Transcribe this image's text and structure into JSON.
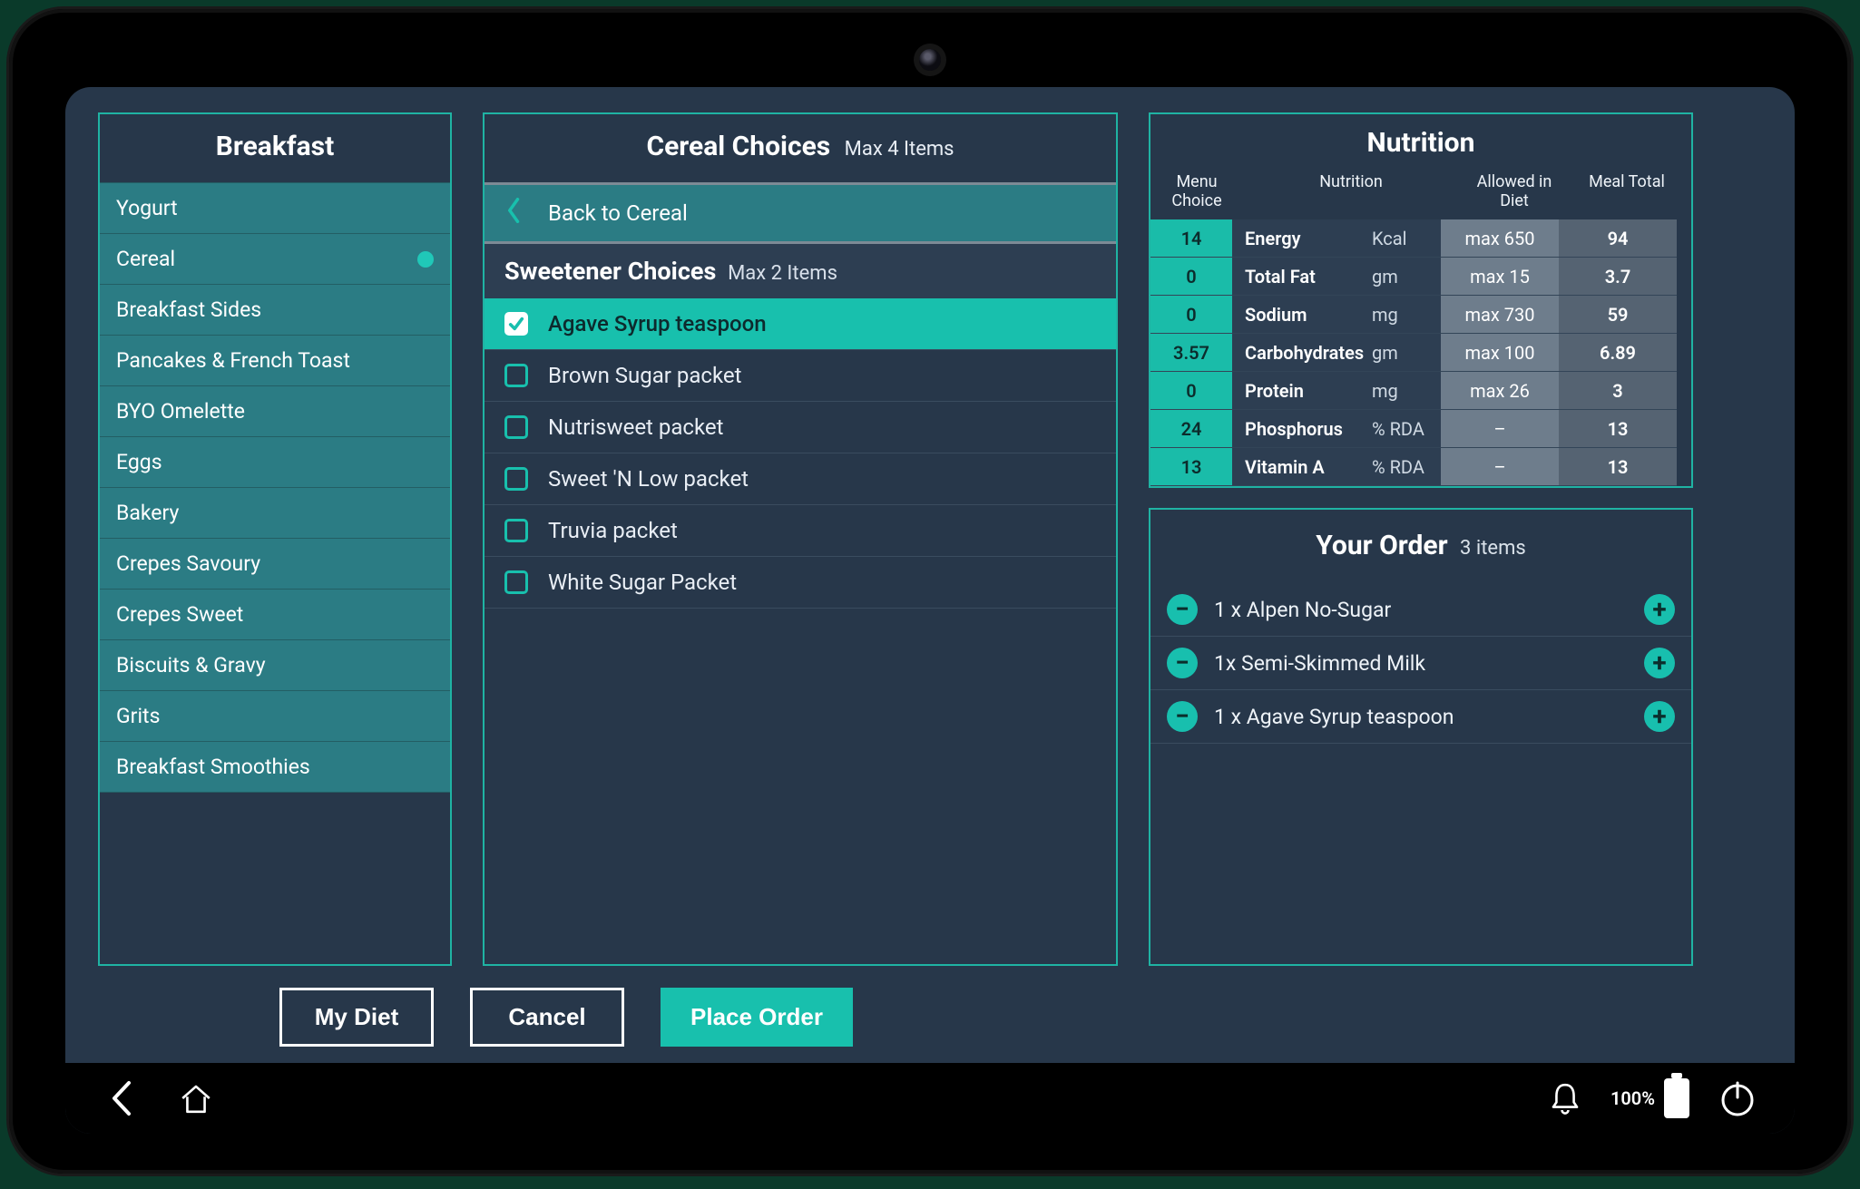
{
  "sidebar": {
    "title": "Breakfast",
    "items": [
      {
        "label": "Yogurt",
        "active": false
      },
      {
        "label": "Cereal",
        "active": true
      },
      {
        "label": "Breakfast Sides",
        "active": false
      },
      {
        "label": "Pancakes & French Toast",
        "active": false
      },
      {
        "label": "BYO Omelette",
        "active": false
      },
      {
        "label": "Eggs",
        "active": false
      },
      {
        "label": "Bakery",
        "active": false
      },
      {
        "label": "Crepes Savoury",
        "active": false
      },
      {
        "label": "Crepes Sweet",
        "active": false
      },
      {
        "label": "Biscuits & Gravy",
        "active": false
      },
      {
        "label": "Grits",
        "active": false
      },
      {
        "label": "Breakfast Smoothies",
        "active": false
      }
    ]
  },
  "choices": {
    "title": "Cereal Choices",
    "title_sub": "Max 4 Items",
    "back_label": "Back to Cereal",
    "subgroup_title": "Sweetener Choices",
    "subgroup_sub": "Max 2 Items",
    "items": [
      {
        "label": "Agave Syrup teaspoon",
        "selected": true
      },
      {
        "label": "Brown Sugar packet",
        "selected": false
      },
      {
        "label": "Nutrisweet packet",
        "selected": false
      },
      {
        "label": "Sweet 'N Low packet",
        "selected": false
      },
      {
        "label": "Truvia packet",
        "selected": false
      },
      {
        "label": "White Sugar Packet",
        "selected": false
      }
    ]
  },
  "nutrition": {
    "title": "Nutrition",
    "heads": {
      "choice": "Menu Choice",
      "nutrition": "Nutrition",
      "allowed": "Allowed in Diet",
      "total": "Meal Total"
    },
    "rows": [
      {
        "value": "14",
        "name": "Energy",
        "unit": "Kcal",
        "allowed": "max 650",
        "total": "94"
      },
      {
        "value": "0",
        "name": "Total Fat",
        "unit": "gm",
        "allowed": "max 15",
        "total": "3.7"
      },
      {
        "value": "0",
        "name": "Sodium",
        "unit": "mg",
        "allowed": "max 730",
        "total": "59"
      },
      {
        "value": "3.57",
        "name": "Carbohydrates",
        "unit": "gm",
        "allowed": "max 100",
        "total": "6.89"
      },
      {
        "value": "0",
        "name": "Protein",
        "unit": "mg",
        "allowed": "max 26",
        "total": "3"
      },
      {
        "value": "24",
        "name": "Phosphorus",
        "unit": "% RDA",
        "allowed": "–",
        "total": "13"
      },
      {
        "value": "13",
        "name": "Vitamin A",
        "unit": "% RDA",
        "allowed": "–",
        "total": "13"
      }
    ]
  },
  "order": {
    "title": "Your Order",
    "title_sub": "3 items",
    "items": [
      {
        "label": "1 x Alpen No-Sugar"
      },
      {
        "label": "1x Semi-Skimmed Milk"
      },
      {
        "label": "1 x Agave Syrup teaspoon"
      }
    ]
  },
  "actions": {
    "my_diet": "My Diet",
    "cancel": "Cancel",
    "place_order": "Place Order"
  },
  "statusbar": {
    "battery_pct": "100%"
  }
}
